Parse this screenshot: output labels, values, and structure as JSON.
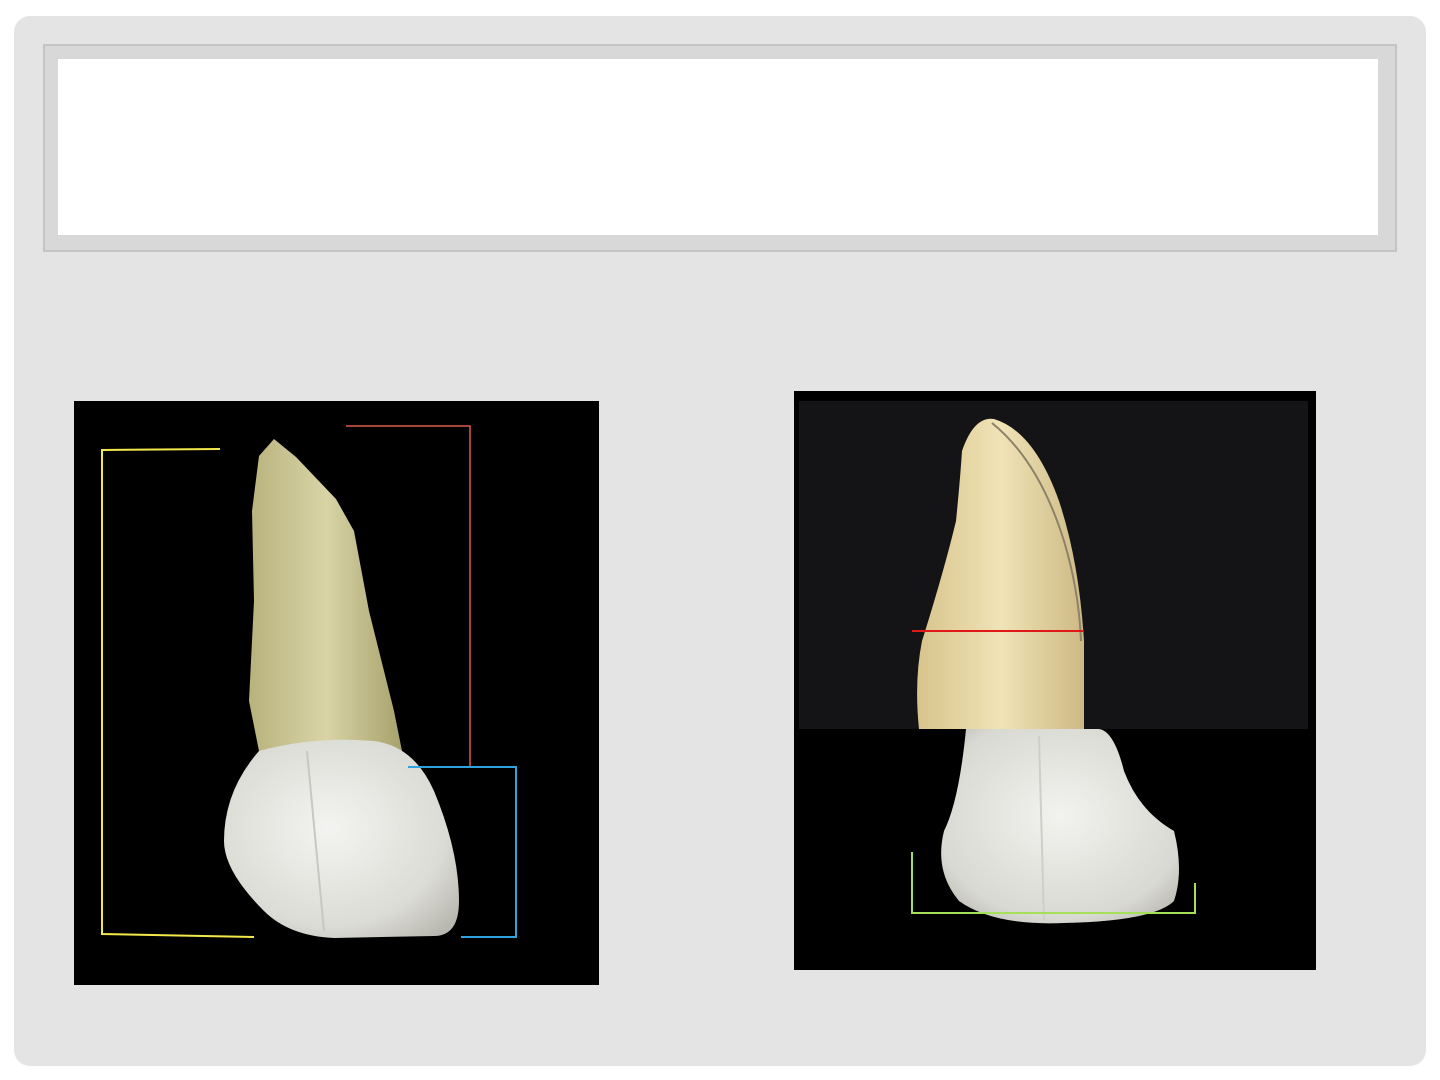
{
  "slide": {
    "title": "",
    "images": [
      {
        "name": "tooth-crown-root-labial-view",
        "background": "#000000"
      },
      {
        "name": "tooth-proximal-view",
        "background": "#000000"
      }
    ]
  },
  "colors": {
    "slide_bg": "#e4e4e4",
    "title_bg": "#ffffff",
    "guide_yellow": "#f3e84a",
    "guide_red": "#e0584e",
    "guide_blue": "#2fa3e0",
    "guide_green": "#a6e05a",
    "line_red": "#e01818"
  }
}
